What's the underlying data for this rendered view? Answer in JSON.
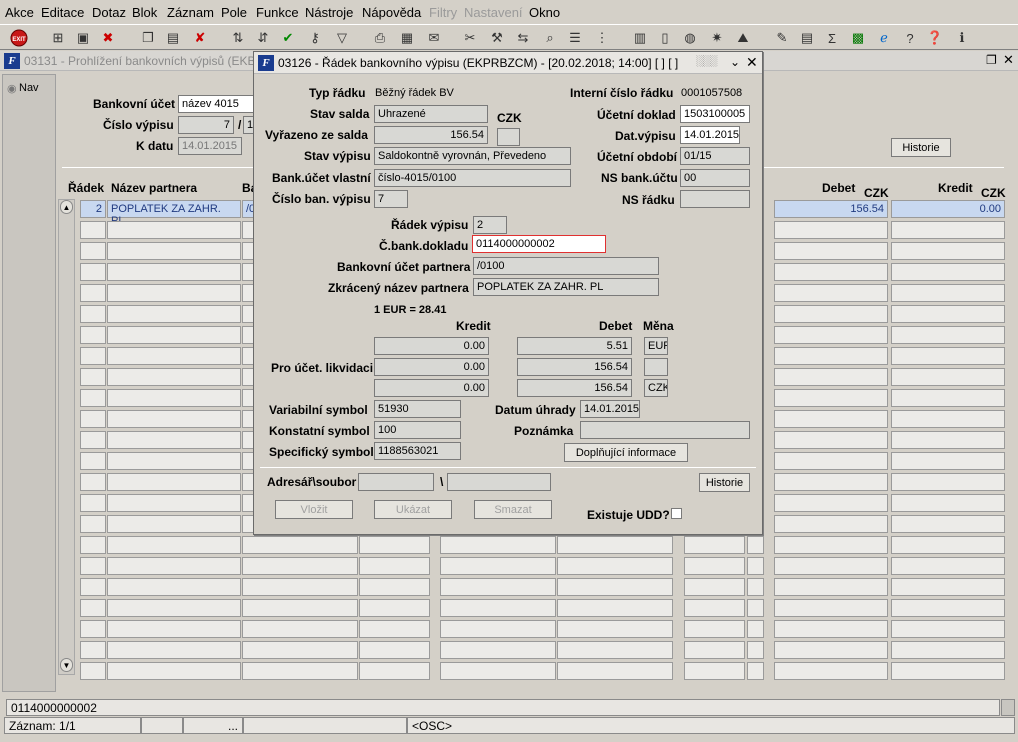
{
  "menu": [
    "Akce",
    "Editace",
    "Dotaz",
    "Blok",
    "Záznam",
    "Pole",
    "Funkce",
    "Nástroje",
    "Nápověda",
    "Filtry",
    "Nastavení",
    "Okno"
  ],
  "toolbar": {
    "exit_label": "EXIT"
  },
  "bg": {
    "title": "03131 - Prohlížení bankovních výpisů (EKB",
    "nav": "Nav",
    "account_label": "Bankovní účet",
    "account_value": "název 4015",
    "stmt_no_label": "Číslo výpisu",
    "stmt_no_value": "7",
    "stmt_no_sep": "/",
    "stmt_no_year": "15",
    "date_label": "K datu",
    "date_value": "14.01.2015",
    "history_btn": "Historie",
    "col_row": "Řádek",
    "col_partner": "Název partnera",
    "col_ba": "Ba",
    "col_debit": "Debet",
    "col_debit_cur": "CZK",
    "col_credit": "Kredit",
    "col_credit_cur": "CZK",
    "row1": {
      "no": "2",
      "partner": "POPLATEK ZA ZAHR. PL",
      "ba": "/0",
      "debit": "156.54",
      "credit": "0.00"
    }
  },
  "dialog": {
    "title": "03126 - Řádek bankovního výpisu (EKPRBZCM) - [20.02.2018; 14:00] [ ] [ ]",
    "type_label": "Typ řádku",
    "type_value": "Běžný řádek BV",
    "internal_label": "Interní číslo řádku",
    "internal_value": "0001057508",
    "status_label": "Stav salda",
    "status_value": "Uhrazené",
    "status_cur": "CZK",
    "acct_doc_label": "Účetní doklad",
    "acct_doc_value": "1503100005",
    "removed_label": "Vyřazeno ze salda",
    "removed_value": "156.54",
    "stmt_date_label": "Dat.výpisu",
    "stmt_date_value": "14.01.2015",
    "stmt_status_label": "Stav výpisu",
    "stmt_status_value": "Saldokontně vyrovnán, Převedeno",
    "period_label": "Účetní období",
    "period_value": "01/15",
    "own_acct_label": "Bank.účet vlastní",
    "own_acct_value": "číslo-4015/0100",
    "ns_acct_label": "NS bank.účtu",
    "ns_acct_value": "00",
    "stmt_no_label": "Číslo ban. výpisu",
    "stmt_no_value": "7",
    "ns_row_label": "NS řádku",
    "ns_row_value": "",
    "row_label": "Řádek výpisu",
    "row_value": "2",
    "bank_doc_label": "Č.bank.dokladu",
    "bank_doc_value": "0114000000002",
    "partner_acct_label": "Bankovní účet partnera",
    "partner_acct_value": "/0100",
    "partner_name_label": "Zkrácený název partnera",
    "partner_name_value": "POPLATEK ZA ZAHR. PL",
    "rate": "1 EUR = 28.41",
    "credit_hdr": "Kredit",
    "debit_hdr": "Debet",
    "currency_hdr": "Měna",
    "liq_label": "Pro účet. likvidaci",
    "liq_rows": [
      {
        "credit": "0.00",
        "debit": "5.51",
        "cur": "EUR"
      },
      {
        "credit": "0.00",
        "debit": "156.54",
        "cur": ""
      },
      {
        "credit": "0.00",
        "debit": "156.54",
        "cur": "CZK"
      }
    ],
    "var_label": "Variabilní symbol",
    "var_value": "51930",
    "pay_date_label": "Datum úhrady",
    "pay_date_value": "14.01.2015",
    "const_label": "Konstatní symbol",
    "const_value": "100",
    "note_label": "Poznámka",
    "note_value": "",
    "spec_label": "Specifický symbol",
    "spec_value": "1188563021",
    "more_btn": "Doplňující informace",
    "dir_label": "Adresář\\soubor",
    "dir_sep": "\\",
    "history_btn": "Historie",
    "insert_btn": "Vložit",
    "show_btn": "Ukázat",
    "delete_btn": "Smazat",
    "udd_label": "Existuje UDD?"
  },
  "status": {
    "value": "0114000000002",
    "record": "Záznam: 1/1",
    "dots": "...",
    "osc": "<OSC>"
  }
}
